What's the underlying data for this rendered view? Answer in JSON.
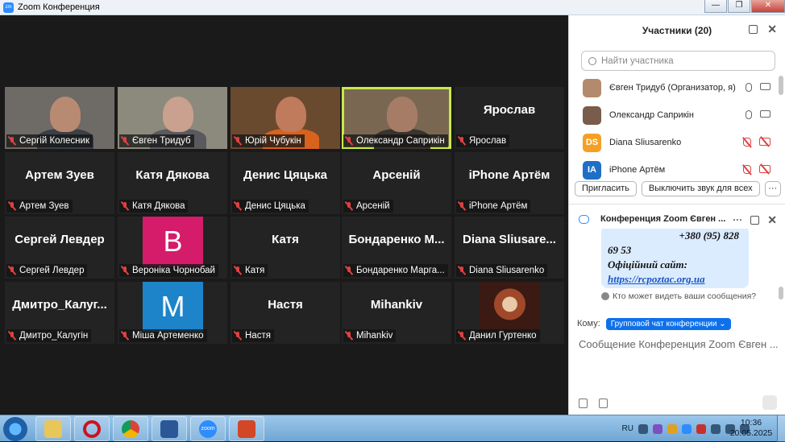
{
  "window": {
    "title": "Zoom Конференция",
    "app_icon": "zm",
    "minimize": "—",
    "maximize": "❐",
    "close": "✕"
  },
  "tiles": [
    {
      "name": "Сергій Колесник",
      "type": "video"
    },
    {
      "name": "Євген Тридуб",
      "type": "video"
    },
    {
      "name": "Юрій Чубукін",
      "type": "video"
    },
    {
      "name": "Олександр Саприкін",
      "type": "video",
      "active": true
    },
    {
      "name": "Ярослав",
      "big": "Ярослав",
      "type": "name"
    },
    {
      "name": "Артем Зуев",
      "big": "Артем Зуев",
      "type": "name"
    },
    {
      "name": "Катя Дякова",
      "big": "Катя Дякова",
      "type": "name"
    },
    {
      "name": "Денис Цяцька",
      "big": "Денис Цяцька",
      "type": "name"
    },
    {
      "name": "Арсеній",
      "big": "Арсеній",
      "type": "name"
    },
    {
      "name": "iPhone Артём",
      "big": "iPhone Артём",
      "type": "name"
    },
    {
      "name": "Сергей Левдер",
      "big": "Сергей Левдер",
      "type": "name"
    },
    {
      "name": "Вероніка Чорнобай",
      "letter": "В",
      "color": "#d41c6a",
      "type": "letter"
    },
    {
      "name": "Катя",
      "big": "Катя",
      "type": "name"
    },
    {
      "name": "Бондаренко Марга...",
      "big": "Бондаренко М...",
      "type": "name"
    },
    {
      "name": "Diana Sliusarenko",
      "big": "Diana Sliusare...",
      "type": "name"
    },
    {
      "name": "Дмитро_Калугін",
      "big": "Дмитро_Калуг...",
      "type": "name"
    },
    {
      "name": "Міша Артеменко",
      "letter": "М",
      "color": "#1d84c9",
      "type": "letter"
    },
    {
      "name": "Настя",
      "big": "Настя",
      "type": "name"
    },
    {
      "name": "Mihankiv",
      "big": "Mihankiv",
      "type": "name"
    },
    {
      "name": "Данил Гуртенко",
      "type": "photo"
    }
  ],
  "participants_panel": {
    "title": "Участники (20)",
    "search_placeholder": "Найти участника",
    "rows": [
      {
        "name": "Євген Тридуб (Организатор, я)",
        "avatar": "",
        "avatar_color": "#b48a6e",
        "muted": false
      },
      {
        "name": "Олександр Саприкін",
        "avatar": "",
        "avatar_color": "#7a5c4c",
        "muted": false
      },
      {
        "name": "Diana Sliusarenko",
        "avatar": "DS",
        "avatar_color": "#f5a025",
        "muted": true
      },
      {
        "name": "iPhone Артём",
        "avatar": "IA",
        "avatar_color": "#1f6fc7",
        "muted": true
      }
    ],
    "invite_label": "Пригласить",
    "mute_all_label": "Выключить звук для всех",
    "more_label": "···"
  },
  "chat_panel": {
    "title": "Конференция Zoom Євген ...",
    "message_phone": "+380 (95) 828",
    "message_line2": "69 53",
    "message_line3": "Офіційний сайт:",
    "message_link": "https://rcpoztac.org.ua",
    "who_can_see": "Кто может видеть ваши сообщения?",
    "to_label": "Кому:",
    "to_value": "Групповой чат конференции",
    "compose_placeholder": "Сообщение Конференция Zoom Євген ..."
  },
  "taskbar": {
    "apps": [
      "windows-explorer",
      "opera",
      "chrome",
      "word",
      "zoom",
      "powerpoint"
    ],
    "zoom_label": "zoom",
    "lang": "RU",
    "time": "10:36",
    "date": "20.05.2025"
  },
  "colors": {
    "active_speaker": "#c8e94a",
    "accent": "#0e71eb",
    "muted_red": "#e04040"
  }
}
